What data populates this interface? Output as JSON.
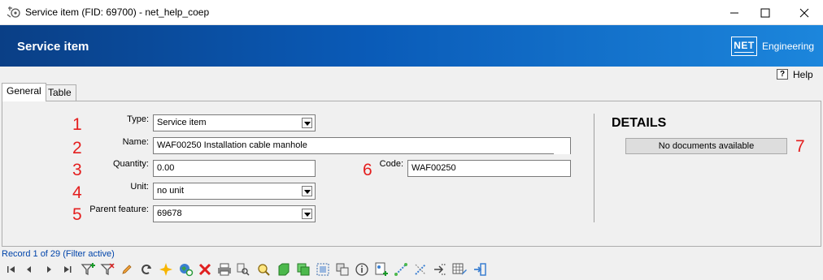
{
  "window": {
    "title": "Service item (FID: 69700) - net_help_coep"
  },
  "header": {
    "title": "Service item",
    "logo_mark": "NET",
    "logo_text": "Engineering"
  },
  "help": {
    "icon_glyph": "?",
    "label": "Help"
  },
  "tabs": [
    {
      "label": "General"
    },
    {
      "label": "Table"
    }
  ],
  "form": {
    "type": {
      "marker": "1",
      "label": "Type:",
      "value": "Service item"
    },
    "name": {
      "marker": "2",
      "label": "Name:",
      "value": "WAF00250 Installation cable manhole"
    },
    "quantity": {
      "marker": "3",
      "label": "Quantity:",
      "value": "0.00"
    },
    "unit": {
      "marker": "4",
      "label": "Unit:",
      "value": "no unit"
    },
    "parent": {
      "marker": "5",
      "label": "Parent feature:",
      "value": "69678"
    },
    "code": {
      "marker": "6",
      "label": "Code:",
      "value": "WAF00250"
    }
  },
  "details": {
    "title": "DETAILS",
    "no_documents": "No documents available",
    "marker": "7"
  },
  "status": {
    "record": "Record 1 of 29 (Filter active)"
  },
  "colors": {
    "annotation": "#e41e1e",
    "header_dark": "#0a3f86",
    "header_light": "#1c86dc",
    "record_text": "#0044aa"
  },
  "toolbar_icons": [
    "first-record-icon",
    "previous-record-icon",
    "next-record-icon",
    "last-record-icon",
    "add-filter-icon",
    "filter-icon",
    "edit-pencil-icon",
    "refresh-icon",
    "new-star-icon",
    "globe-refresh-icon",
    "delete-x-icon",
    "print-icon",
    "search-zoom-icon",
    "zoom-icon",
    "green-box-icon",
    "green-copy-icon",
    "select-frame-icon",
    "duplicate-icon",
    "info-icon",
    "add-document-icon",
    "connect-line-icon",
    "disconnect-line-icon",
    "route-icon",
    "table-edit-icon",
    "exit-icon"
  ]
}
